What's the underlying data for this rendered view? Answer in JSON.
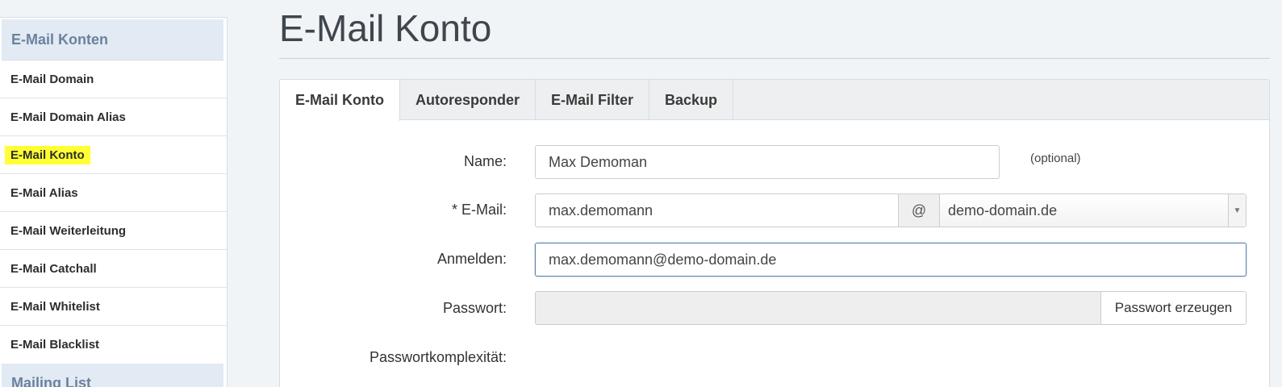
{
  "sidebar": {
    "header": "E-Mail Konten",
    "items": [
      {
        "label": "E-Mail Domain"
      },
      {
        "label": "E-Mail Domain Alias"
      },
      {
        "label": "E-Mail Konto"
      },
      {
        "label": "E-Mail Alias"
      },
      {
        "label": "E-Mail Weiterleitung"
      },
      {
        "label": "E-Mail Catchall"
      },
      {
        "label": "E-Mail Whitelist"
      },
      {
        "label": "E-Mail Blacklist"
      }
    ],
    "next_header": "Mailing List"
  },
  "page": {
    "title": "E-Mail Konto"
  },
  "tabs": [
    {
      "label": "E-Mail Konto"
    },
    {
      "label": "Autoresponder"
    },
    {
      "label": "E-Mail Filter"
    },
    {
      "label": "Backup"
    }
  ],
  "form": {
    "name_label": "Name:",
    "name_value": "Max Demoman",
    "name_hint": "(optional)",
    "email_label": "* E-Mail:",
    "email_local": "max.demomann",
    "email_at": "@",
    "email_domain": "demo-domain.de",
    "login_label": "Anmelden:",
    "login_value": "max.demomann@demo-domain.de",
    "password_label": "Passwort:",
    "password_value": "",
    "password_button": "Passwort erzeugen",
    "complexity_label": "Passwortkomplexität:"
  },
  "colors": {
    "highlight": "#ffff33",
    "sidebar_header_bg": "#e2eaf3",
    "focus_border": "#5b82b0"
  }
}
